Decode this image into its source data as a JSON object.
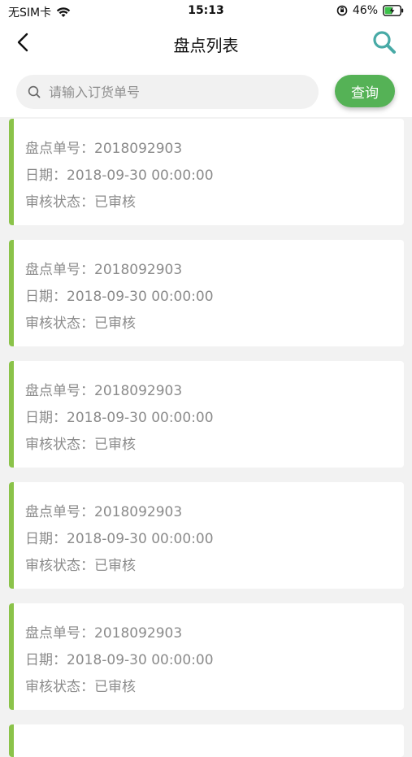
{
  "status_bar": {
    "carrier": "无SIM卡",
    "time": "15:13",
    "battery": "46%"
  },
  "nav": {
    "title": "盘点列表",
    "back_icon": "chevron-left-icon",
    "search_icon": "search-icon"
  },
  "search": {
    "placeholder": "请输入订货单号",
    "value": "",
    "button_label": "查询"
  },
  "colors": {
    "accent": "#8bc34a",
    "button": "#55b256",
    "search_icon": "#48aaa6"
  },
  "records": [
    {
      "order_label": "盘点单号：",
      "order_no": "2018092903",
      "date_label": "日期：",
      "date": "2018-09-30 00:00:00",
      "status_label": "审核状态：",
      "status": "已审核"
    },
    {
      "order_label": "盘点单号：",
      "order_no": "2018092903",
      "date_label": "日期：",
      "date": "2018-09-30 00:00:00",
      "status_label": "审核状态：",
      "status": "已审核"
    },
    {
      "order_label": "盘点单号：",
      "order_no": "2018092903",
      "date_label": "日期：",
      "date": "2018-09-30 00:00:00",
      "status_label": "审核状态：",
      "status": "已审核"
    },
    {
      "order_label": "盘点单号：",
      "order_no": "2018092903",
      "date_label": "日期：",
      "date": "2018-09-30 00:00:00",
      "status_label": "审核状态：",
      "status": "已审核"
    },
    {
      "order_label": "盘点单号：",
      "order_no": "2018092903",
      "date_label": "日期：",
      "date": "2018-09-30 00:00:00",
      "status_label": "审核状态：",
      "status": "已审核"
    }
  ]
}
